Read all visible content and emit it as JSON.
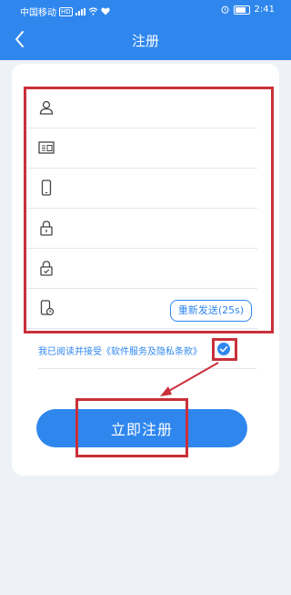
{
  "status_bar": {
    "carrier": "中国移动",
    "hd": "HD",
    "time": "2:41"
  },
  "header": {
    "title": "注册"
  },
  "form": {
    "fields": [
      {
        "icon": "user-icon",
        "placeholder": ""
      },
      {
        "icon": "id-card-icon",
        "placeholder": ""
      },
      {
        "icon": "phone-icon",
        "placeholder": ""
      },
      {
        "icon": "lock-icon",
        "placeholder": ""
      },
      {
        "icon": "shield-check-icon",
        "placeholder": ""
      },
      {
        "icon": "sms-code-icon",
        "placeholder": ""
      }
    ],
    "resend_label": "重新发送(25s)",
    "agreement_text": "我已阅读并接受《软件服务及隐私条款》",
    "agreement_checked": true,
    "submit_label": "立即注册"
  },
  "colors": {
    "brand": "#2f87ee",
    "highlight": "#c9303a",
    "background": "#eef1f5"
  }
}
